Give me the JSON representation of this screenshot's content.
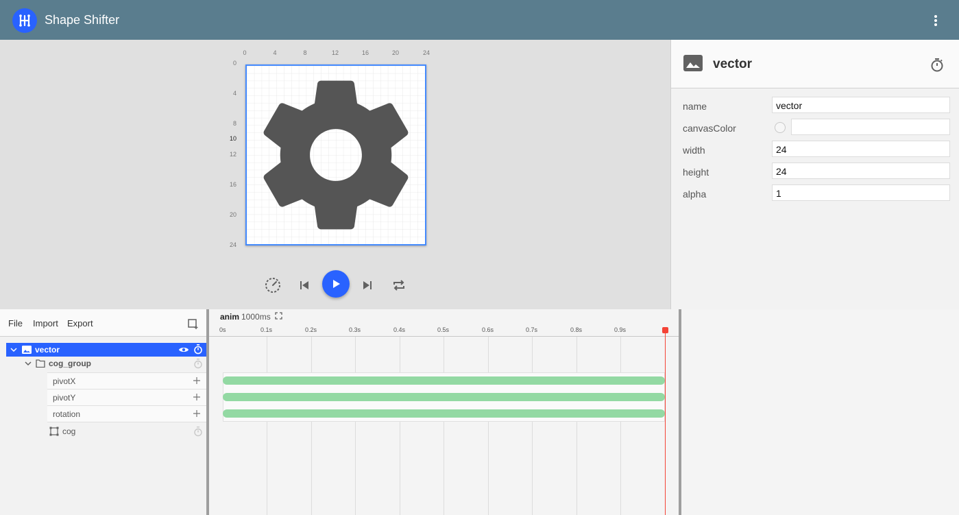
{
  "app": {
    "title": "Shape Shifter"
  },
  "canvas": {
    "ruler_top": [
      "0",
      "4",
      "8",
      "12",
      "16",
      "20",
      "24"
    ],
    "ruler_left": [
      "0",
      "4",
      "8",
      "10",
      "12",
      "16",
      "20",
      "24"
    ],
    "fill_color": "#555555",
    "selection_color": "#448aff"
  },
  "player": {
    "buttons": [
      "speed-icon",
      "skip-previous-icon",
      "play-icon",
      "skip-next-icon",
      "repeat-icon"
    ],
    "accent": "#2962ff"
  },
  "properties": {
    "title": "vector",
    "rows": [
      {
        "label": "name",
        "value": "vector"
      },
      {
        "label": "canvasColor",
        "value": ""
      },
      {
        "label": "width",
        "value": "24"
      },
      {
        "label": "height",
        "value": "24"
      },
      {
        "label": "alpha",
        "value": "1"
      }
    ]
  },
  "layers": {
    "menu": [
      "File",
      "Import",
      "Export"
    ],
    "tree": {
      "vector": "vector",
      "group": "cog_group",
      "properties": [
        "pivotX",
        "pivotY",
        "rotation"
      ],
      "path": "cog"
    }
  },
  "timeline": {
    "animation_name": "anim",
    "duration": "1000ms",
    "ticks": [
      "0s",
      "0.1s",
      "0.2s",
      "0.3s",
      "0.4s",
      "0.5s",
      "0.6s",
      "0.7s",
      "0.8s",
      "0.9s"
    ],
    "block_color": "#93d9a3",
    "playhead_color": "#f44336"
  }
}
